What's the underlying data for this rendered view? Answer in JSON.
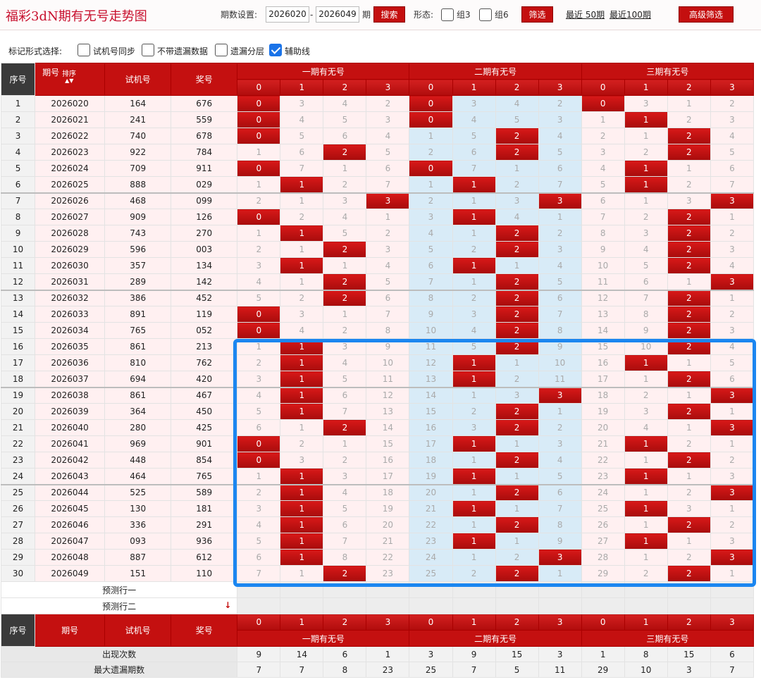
{
  "app_title": "福彩3dN期有无号走势图",
  "topbar": {
    "period_label": "期数设置:",
    "start_period": "2026020",
    "dash": "-",
    "end_period": "2026049",
    "period_unit": "期",
    "search_button": "搜索",
    "form_label": "形态:",
    "group3_label": "组3",
    "group6_label": "组6",
    "filter_button": "筛选",
    "recent50": "最近 50期",
    "recent100": "最近100期",
    "advanced_button": "高级筛选"
  },
  "options": {
    "label": "标记形式选择:",
    "items": [
      {
        "label": "试机号同步",
        "checked": false
      },
      {
        "label": "不带遗漏数据",
        "checked": false
      },
      {
        "label": "遗漏分层",
        "checked": false
      },
      {
        "label": "辅助线",
        "checked": true
      }
    ]
  },
  "header": {
    "seq": "序号",
    "period": "期号",
    "sort": "排序",
    "trial": "试机号",
    "prize": "奖号",
    "groups": [
      "一期有无号",
      "二期有无号",
      "三期有无号"
    ],
    "digits": [
      "0",
      "1",
      "2",
      "3"
    ]
  },
  "rows": [
    {
      "n": "1",
      "p": "2026020",
      "t": "164",
      "w": "676",
      "c": [
        "0",
        "3",
        "4",
        "2",
        "0",
        "3",
        "4",
        "2",
        "0",
        "3",
        "1",
        "2"
      ],
      "h": [
        0,
        4,
        8
      ]
    },
    {
      "n": "2",
      "p": "2026021",
      "t": "241",
      "w": "559",
      "c": [
        "0",
        "4",
        "5",
        "3",
        "0",
        "4",
        "5",
        "3",
        "1",
        "1",
        "2",
        "3"
      ],
      "h": [
        0,
        4,
        9
      ]
    },
    {
      "n": "3",
      "p": "2026022",
      "t": "740",
      "w": "678",
      "c": [
        "0",
        "5",
        "6",
        "4",
        "1",
        "5",
        "2",
        "4",
        "2",
        "1",
        "2",
        "4"
      ],
      "h": [
        0,
        6,
        10
      ]
    },
    {
      "n": "4",
      "p": "2026023",
      "t": "922",
      "w": "784",
      "c": [
        "1",
        "6",
        "2",
        "5",
        "2",
        "6",
        "2",
        "5",
        "3",
        "2",
        "2",
        "5"
      ],
      "h": [
        2,
        6,
        10
      ]
    },
    {
      "n": "5",
      "p": "2026024",
      "t": "709",
      "w": "911",
      "c": [
        "0",
        "7",
        "1",
        "6",
        "0",
        "7",
        "1",
        "6",
        "4",
        "1",
        "1",
        "6"
      ],
      "h": [
        0,
        4,
        9
      ]
    },
    {
      "n": "6",
      "p": "2026025",
      "t": "888",
      "w": "029",
      "c": [
        "1",
        "1",
        "2",
        "7",
        "1",
        "1",
        "2",
        "7",
        "5",
        "1",
        "2",
        "7"
      ],
      "h": [
        1,
        5,
        9
      ]
    },
    {
      "n": "7",
      "p": "2026026",
      "t": "468",
      "w": "099",
      "c": [
        "2",
        "1",
        "3",
        "3",
        "2",
        "1",
        "3",
        "3",
        "6",
        "1",
        "3",
        "3"
      ],
      "h": [
        3,
        7,
        11
      ]
    },
    {
      "n": "8",
      "p": "2026027",
      "t": "909",
      "w": "126",
      "c": [
        "0",
        "2",
        "4",
        "1",
        "3",
        "1",
        "4",
        "1",
        "7",
        "2",
        "2",
        "1"
      ],
      "h": [
        0,
        5,
        10
      ]
    },
    {
      "n": "9",
      "p": "2026028",
      "t": "743",
      "w": "270",
      "c": [
        "1",
        "1",
        "5",
        "2",
        "4",
        "1",
        "2",
        "2",
        "8",
        "3",
        "2",
        "2"
      ],
      "h": [
        1,
        6,
        10
      ]
    },
    {
      "n": "10",
      "p": "2026029",
      "t": "596",
      "w": "003",
      "c": [
        "2",
        "1",
        "2",
        "3",
        "5",
        "2",
        "2",
        "3",
        "9",
        "4",
        "2",
        "3"
      ],
      "h": [
        2,
        6,
        10
      ]
    },
    {
      "n": "11",
      "p": "2026030",
      "t": "357",
      "w": "134",
      "c": [
        "3",
        "1",
        "1",
        "4",
        "6",
        "1",
        "1",
        "4",
        "10",
        "5",
        "2",
        "4"
      ],
      "h": [
        1,
        5,
        10
      ]
    },
    {
      "n": "12",
      "p": "2026031",
      "t": "289",
      "w": "142",
      "c": [
        "4",
        "1",
        "2",
        "5",
        "7",
        "1",
        "2",
        "5",
        "11",
        "6",
        "1",
        "3"
      ],
      "h": [
        2,
        6,
        11
      ]
    },
    {
      "n": "13",
      "p": "2026032",
      "t": "386",
      "w": "452",
      "c": [
        "5",
        "2",
        "2",
        "6",
        "8",
        "2",
        "2",
        "6",
        "12",
        "7",
        "2",
        "1"
      ],
      "h": [
        2,
        6,
        10
      ]
    },
    {
      "n": "14",
      "p": "2026033",
      "t": "891",
      "w": "119",
      "c": [
        "0",
        "3",
        "1",
        "7",
        "9",
        "3",
        "2",
        "7",
        "13",
        "8",
        "2",
        "2"
      ],
      "h": [
        0,
        6,
        10
      ]
    },
    {
      "n": "15",
      "p": "2026034",
      "t": "765",
      "w": "052",
      "c": [
        "0",
        "4",
        "2",
        "8",
        "10",
        "4",
        "2",
        "8",
        "14",
        "9",
        "2",
        "3"
      ],
      "h": [
        0,
        6,
        10
      ]
    },
    {
      "n": "16",
      "p": "2026035",
      "t": "861",
      "w": "213",
      "c": [
        "1",
        "1",
        "3",
        "9",
        "11",
        "5",
        "2",
        "9",
        "15",
        "10",
        "2",
        "4"
      ],
      "h": [
        1,
        6,
        10
      ]
    },
    {
      "n": "17",
      "p": "2026036",
      "t": "810",
      "w": "762",
      "c": [
        "2",
        "1",
        "4",
        "10",
        "12",
        "1",
        "1",
        "10",
        "16",
        "1",
        "1",
        "5"
      ],
      "h": [
        1,
        5,
        9
      ]
    },
    {
      "n": "18",
      "p": "2026037",
      "t": "694",
      "w": "420",
      "c": [
        "3",
        "1",
        "5",
        "11",
        "13",
        "1",
        "2",
        "11",
        "17",
        "1",
        "2",
        "6"
      ],
      "h": [
        1,
        5,
        10
      ]
    },
    {
      "n": "19",
      "p": "2026038",
      "t": "861",
      "w": "467",
      "c": [
        "4",
        "1",
        "6",
        "12",
        "14",
        "1",
        "3",
        "3",
        "18",
        "2",
        "1",
        "3"
      ],
      "h": [
        1,
        7,
        11
      ]
    },
    {
      "n": "20",
      "p": "2026039",
      "t": "364",
      "w": "450",
      "c": [
        "5",
        "1",
        "7",
        "13",
        "15",
        "2",
        "2",
        "1",
        "19",
        "3",
        "2",
        "1"
      ],
      "h": [
        1,
        6,
        10
      ]
    },
    {
      "n": "21",
      "p": "2026040",
      "t": "280",
      "w": "425",
      "c": [
        "6",
        "1",
        "2",
        "14",
        "16",
        "3",
        "2",
        "2",
        "20",
        "4",
        "1",
        "3"
      ],
      "h": [
        2,
        6,
        11
      ]
    },
    {
      "n": "22",
      "p": "2026041",
      "t": "969",
      "w": "901",
      "c": [
        "0",
        "2",
        "1",
        "15",
        "17",
        "1",
        "1",
        "3",
        "21",
        "1",
        "2",
        "1"
      ],
      "h": [
        0,
        5,
        9
      ]
    },
    {
      "n": "23",
      "p": "2026042",
      "t": "448",
      "w": "854",
      "c": [
        "0",
        "3",
        "2",
        "16",
        "18",
        "1",
        "2",
        "4",
        "22",
        "1",
        "2",
        "2"
      ],
      "h": [
        0,
        6,
        10
      ]
    },
    {
      "n": "24",
      "p": "2026043",
      "t": "464",
      "w": "765",
      "c": [
        "1",
        "1",
        "3",
        "17",
        "19",
        "1",
        "1",
        "5",
        "23",
        "1",
        "1",
        "3"
      ],
      "h": [
        1,
        5,
        9
      ]
    },
    {
      "n": "25",
      "p": "2026044",
      "t": "525",
      "w": "589",
      "c": [
        "2",
        "1",
        "4",
        "18",
        "20",
        "1",
        "2",
        "6",
        "24",
        "1",
        "2",
        "3"
      ],
      "h": [
        1,
        6,
        11
      ]
    },
    {
      "n": "26",
      "p": "2026045",
      "t": "130",
      "w": "181",
      "c": [
        "3",
        "1",
        "5",
        "19",
        "21",
        "1",
        "1",
        "7",
        "25",
        "1",
        "3",
        "1"
      ],
      "h": [
        1,
        5,
        9
      ]
    },
    {
      "n": "27",
      "p": "2026046",
      "t": "336",
      "w": "291",
      "c": [
        "4",
        "1",
        "6",
        "20",
        "22",
        "1",
        "2",
        "8",
        "26",
        "1",
        "2",
        "2"
      ],
      "h": [
        1,
        6,
        10
      ]
    },
    {
      "n": "28",
      "p": "2026047",
      "t": "093",
      "w": "936",
      "c": [
        "5",
        "1",
        "7",
        "21",
        "23",
        "1",
        "1",
        "9",
        "27",
        "1",
        "1",
        "3"
      ],
      "h": [
        1,
        5,
        9
      ]
    },
    {
      "n": "29",
      "p": "2026048",
      "t": "887",
      "w": "612",
      "c": [
        "6",
        "1",
        "8",
        "22",
        "24",
        "1",
        "2",
        "3",
        "28",
        "1",
        "2",
        "3"
      ],
      "h": [
        1,
        7,
        11
      ]
    },
    {
      "n": "30",
      "p": "2026049",
      "t": "151",
      "w": "110",
      "c": [
        "7",
        "1",
        "2",
        "23",
        "25",
        "2",
        "2",
        "1",
        "29",
        "2",
        "2",
        "1"
      ],
      "h": [
        2,
        6,
        10
      ]
    }
  ],
  "predict_rows": [
    "预测行一",
    "预测行二"
  ],
  "footer": {
    "stats": [
      {
        "label": "出现次数",
        "values": [
          "9",
          "14",
          "6",
          "1",
          "3",
          "9",
          "15",
          "3",
          "1",
          "8",
          "15",
          "6"
        ]
      },
      {
        "label": "最大遗漏期数",
        "values": [
          "7",
          "7",
          "8",
          "23",
          "25",
          "7",
          "5",
          "11",
          "29",
          "10",
          "3",
          "7"
        ]
      }
    ]
  },
  "colors": {
    "accent": "#c41010",
    "hit": "#c41010",
    "blue_band": "#d8ebf7",
    "selection": "#1b86f0"
  }
}
